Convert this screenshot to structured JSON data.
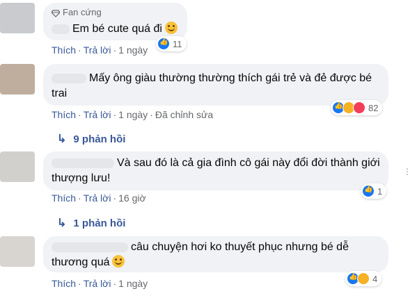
{
  "comments": [
    {
      "badge": "Fan cứng",
      "text": "Em bé cute quá đi",
      "actions": {
        "like": "Thích",
        "reply": "Trả lời",
        "time": "1 ngày",
        "edited": ""
      },
      "reactions": {
        "count": "11",
        "types": [
          "like"
        ]
      }
    },
    {
      "badge": "",
      "text": "Mấy ông giàu thường thường thích gái trẻ và đẻ được bé trai",
      "actions": {
        "like": "Thích",
        "reply": "Trả lời",
        "time": "1 ngày",
        "edited": "Đã chỉnh sửa"
      },
      "reactions": {
        "count": "82",
        "types": [
          "like",
          "haha",
          "love"
        ]
      },
      "replies": "9 phản hồi"
    },
    {
      "badge": "",
      "text": "Và sau đó là cả gia đình cô gái này đổi đời thành giới thượng lưu!",
      "actions": {
        "like": "Thích",
        "reply": "Trả lời",
        "time": "16 giờ",
        "edited": ""
      },
      "reactions": {
        "count": "1",
        "types": [
          "like"
        ]
      },
      "replies": "1 phản hồi"
    },
    {
      "badge": "",
      "text": "câu chuyện hơi ko thuyết phục nhưng bé dễ thương quá",
      "actions": {
        "like": "Thích",
        "reply": "Trả lời",
        "time": "1 ngày",
        "edited": ""
      },
      "reactions": {
        "count": "4",
        "types": [
          "like",
          "haha"
        ]
      }
    }
  ],
  "icons": {
    "badge": "diamond-icon",
    "reply_arrow": "reply-arrow-icon",
    "like": "like-icon",
    "haha": "haha-icon",
    "love": "love-icon"
  },
  "colors": {
    "link": "#385898",
    "bubble": "#f0f2f5",
    "like": "#1877f2",
    "haha": "#f7b125",
    "love": "#f33e58"
  }
}
